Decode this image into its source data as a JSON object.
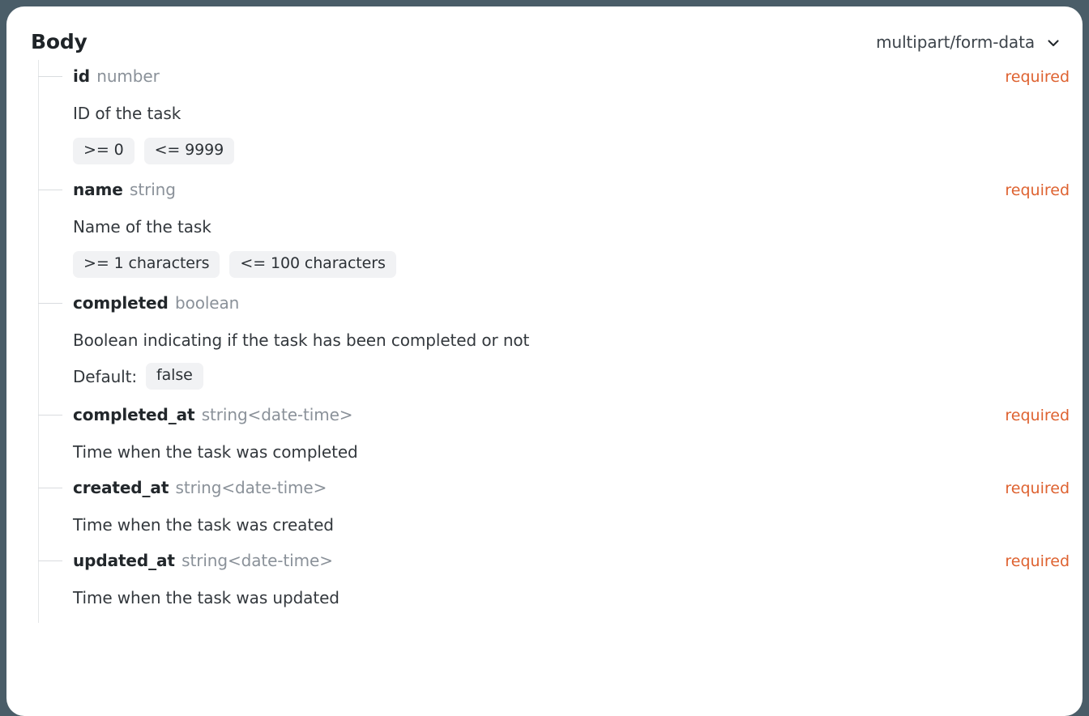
{
  "panel": {
    "title": "Body",
    "content_type": "multipart/form-data",
    "chevron_icon": "chevron-down-icon",
    "required_color": "#de6230",
    "chip_bg": "#f1f2f4",
    "card_bg": "#ffffff",
    "page_bg": "#4a5d68"
  },
  "required_label": "required",
  "default_label": "Default:",
  "properties": [
    {
      "name": "id",
      "type": "number",
      "required": "required",
      "description": "ID of the task",
      "constraints": [
        ">= 0",
        "<= 9999"
      ],
      "default": null
    },
    {
      "name": "name",
      "type": "string",
      "required": "required",
      "description": "Name of the task",
      "constraints": [
        ">= 1 characters",
        "<= 100 characters"
      ],
      "default": null
    },
    {
      "name": "completed",
      "type": "boolean",
      "required": "",
      "description": "Boolean indicating if the task has been completed or not",
      "constraints": [],
      "default": "false"
    },
    {
      "name": "completed_at",
      "type": "string<date-time>",
      "required": "required",
      "description": "Time when the task was completed",
      "constraints": [],
      "default": null
    },
    {
      "name": "created_at",
      "type": "string<date-time>",
      "required": "required",
      "description": "Time when the task was created",
      "constraints": [],
      "default": null
    },
    {
      "name": "updated_at",
      "type": "string<date-time>",
      "required": "required",
      "description": "Time when the task was updated",
      "constraints": [],
      "default": null
    }
  ]
}
